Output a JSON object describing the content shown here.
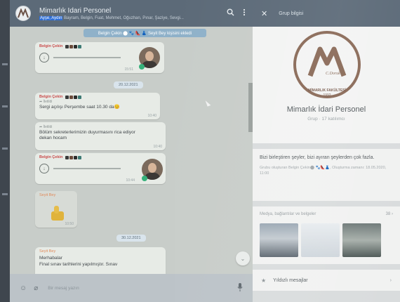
{
  "header": {
    "title": "Mimarlık İdari Personel",
    "subtitle_highlight": "Ayşe, Aydın",
    "subtitle_rest": "Bayram, Belgin, Fuat, Mehmet, Oğuzhan, Pınar, Şaziye, Sevgi..."
  },
  "system_note": "Belgin Çekin ⬤ 🐾 👠 👗 Seyit Bey kişisini ekledi",
  "messages": {
    "voice1": {
      "sender": "Belgin Çekin",
      "time": "15:51"
    },
    "date1": "20.12.2021",
    "msg1": {
      "sender": "Belgin Çekin",
      "forwarded": "İletildi",
      "text": "Sergi açılışı Perşembe saat 10.30 da😊",
      "time": "10:40"
    },
    "msg2": {
      "forwarded": "İletildi",
      "text": "Bölüm sekreterlerimizin duyurmasını rica ediyor dekan hocam",
      "time": "10:40"
    },
    "voice2": {
      "sender": "Belgin Çekin",
      "time": "10:44"
    },
    "sticker": {
      "sender": "Seyit Bey",
      "time": "10:50"
    },
    "date2": "30.12.2021",
    "msg3": {
      "sender": "Seyit Bey",
      "text1": "Merhabalar",
      "text2": "Final sınav tarihlerini yapılmıştır. Sınav"
    }
  },
  "composer": {
    "placeholder": "Bir mesaj yazın"
  },
  "panel": {
    "title": "Grup bilgisi",
    "logo_top": "C.Doruk",
    "logo_text": "MİMARLIK FAKÜLTESİ",
    "logo_year": "1992",
    "group_name": "Mimarlık İdari Personel",
    "group_meta": "Grup · 17 katılımcı",
    "description": "Bizi birleştiren şeyler, bizi ayıran şeylerden çok fazla.",
    "created_by": "Grubu oluşturan Belgin Çekin⬤ 🐾👠👗, Oluşturma zamanı: 18.05.2020, 11:00",
    "media_label": "Medya, bağlantılar ve belgeler",
    "media_count": "38 ›",
    "starred": "Yıldızlı mesajlar"
  },
  "colors": {
    "header_bg": "#5c6a78",
    "chat_bg": "#c8cdc9",
    "bubble": "#e7ebe6",
    "sender": "#c94b4b",
    "logo_brown": "#8a6a58"
  }
}
